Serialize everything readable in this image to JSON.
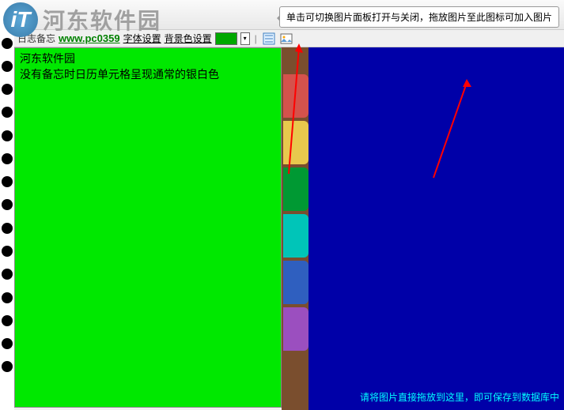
{
  "watermark": {
    "logo_letter": "iT",
    "site_name": "河东软件园"
  },
  "tooltip": {
    "text": "单击可切换图片面板打开与关闭，拖放图片至此图标可加入图片"
  },
  "secondary_bar": {
    "label_prefix": "日志备忘",
    "url": "www.pc0359",
    "font_setting": "字体设置",
    "bg_setting": "背景色设置"
  },
  "editor": {
    "line1": "河东软件园",
    "line2": "没有备忘时日历单元格呈现通常的银白色"
  },
  "tabs": {
    "colors": [
      "#D4524C",
      "#E8C84D",
      "#009933",
      "#00C5B8",
      "#2F5FBF",
      "#9B4FBF"
    ]
  },
  "right_panel": {
    "drop_hint": "请将图片直接拖放到这里，即可保存到数据库中"
  }
}
